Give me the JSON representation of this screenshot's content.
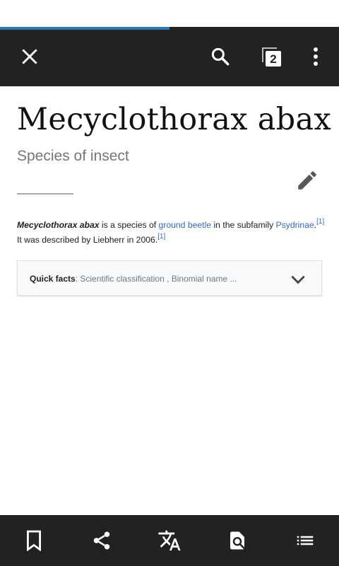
{
  "toolbar": {
    "tabs_count": "2",
    "close_icon": "close-icon",
    "search_icon": "search-icon",
    "tabs_icon": "tabs-icon",
    "overflow_icon": "overflow-menu-icon",
    "background": "#222222"
  },
  "page_load_progress": 0.5,
  "article": {
    "title": "Mecyclothorax abax",
    "description": "Species of insect",
    "para_parts": [
      {
        "text": "Mecyclothorax abax",
        "style": "bold-italic"
      },
      {
        "text": " is a species of ",
        "style": "plain"
      },
      {
        "text": "ground beetle",
        "style": "link"
      },
      {
        "text": " in the subfamily ",
        "style": "plain"
      },
      {
        "text": "Psydrinae",
        "style": "link"
      },
      {
        "text": ".",
        "style": "plain"
      },
      {
        "text": "[1]",
        "style": "ref"
      },
      {
        "text": " It was described by Liebherr in 2006.",
        "style": "plain"
      },
      {
        "text": "[1]",
        "style": "ref"
      }
    ],
    "link_color": "#3366cc"
  },
  "quick_facts": {
    "label": "Quick facts",
    "summary": ": Scientific classification , Binomial name ..."
  },
  "bottom_bar": {
    "icons": [
      "bookmark-icon",
      "share-icon",
      "translate-icon",
      "find-in-page-icon",
      "contents-list-icon"
    ]
  }
}
